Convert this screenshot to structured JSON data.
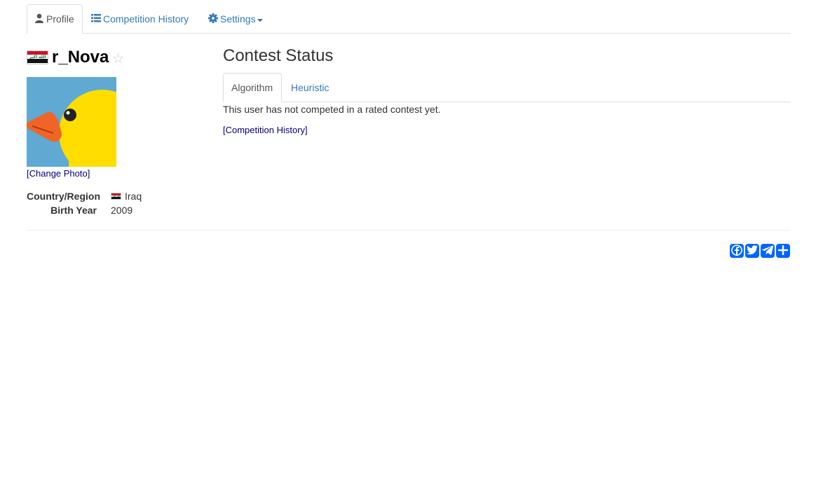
{
  "nav": {
    "tabs": [
      {
        "label": "Profile",
        "icon": "user-icon",
        "active": true
      },
      {
        "label": "Competition History",
        "icon": "list-icon"
      },
      {
        "label": "Settings",
        "icon": "gear-icon",
        "dropdown": true
      }
    ]
  },
  "profile": {
    "username": "r_Nova",
    "flag_script": "الله اكبر",
    "change_photo_label": "[Change Photo]",
    "info": [
      {
        "label": "Country/Region",
        "value": "Iraq"
      },
      {
        "label": "Birth Year",
        "value": "2009"
      }
    ]
  },
  "contest": {
    "title": "Contest Status",
    "tabs": [
      {
        "label": "Algorithm",
        "active": true
      },
      {
        "label": "Heuristic"
      }
    ],
    "message": "This user has not competed in a rated contest yet.",
    "history_link": "[Competition History]"
  },
  "share": {
    "buttons": [
      "facebook-icon",
      "twitter-icon",
      "telegram-icon",
      "share-plus-icon"
    ]
  },
  "colors": {
    "link": "#337ab7",
    "navy_link": "#000080",
    "share_blue": "#0166ff",
    "duck_yellow": "#ffdd00",
    "duck_beak": "#f06527",
    "avatar_bg": "#5fa9d3"
  }
}
